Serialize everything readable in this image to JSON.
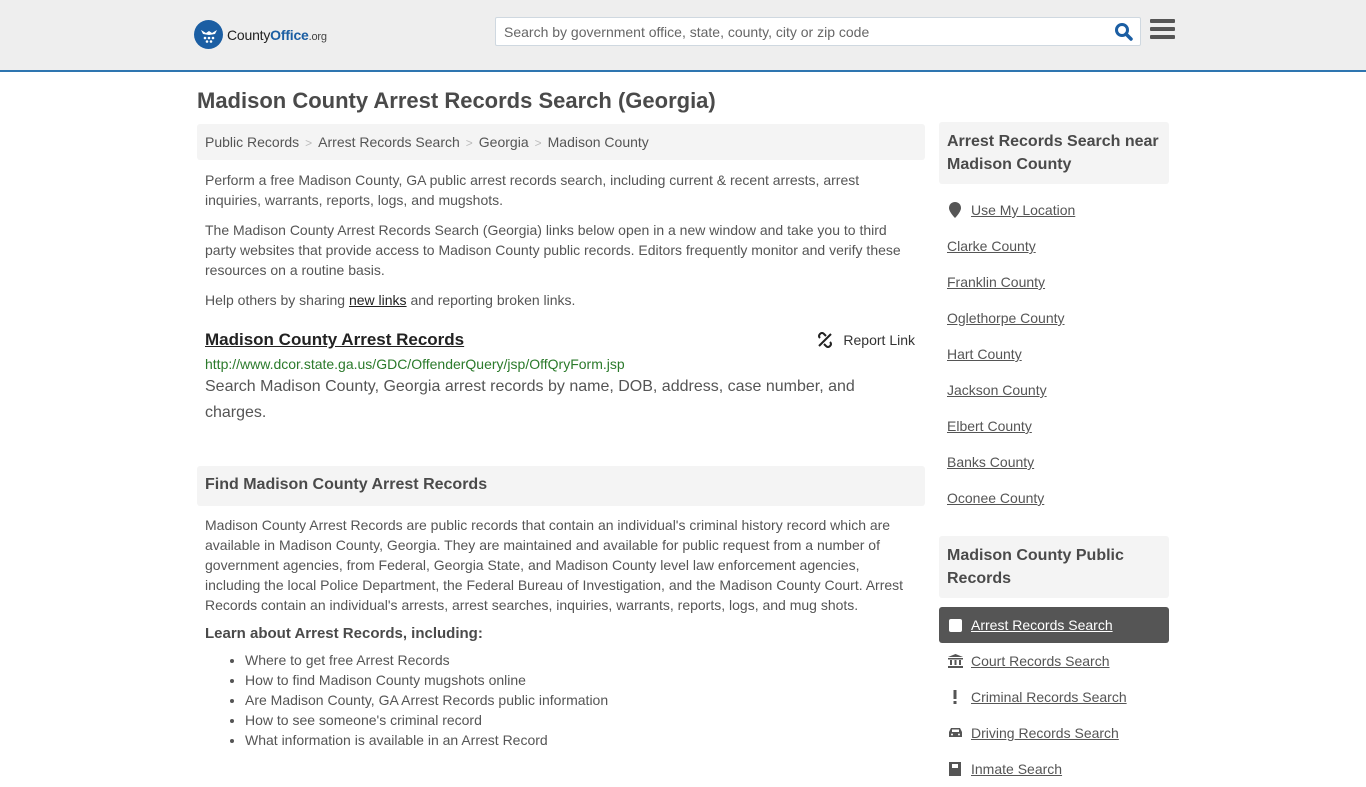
{
  "header": {
    "logo": {
      "county": "County",
      "office": "Office",
      "org": ".org"
    },
    "search": {
      "placeholder": "Search by government office, state, county, city or zip code",
      "value": ""
    },
    "colors": {
      "accent": "#2e75b0",
      "brand": "#1b5ea3",
      "url_green": "#2b7a2b"
    }
  },
  "page": {
    "title": "Madison County Arrest Records Search (Georgia)"
  },
  "breadcrumb": [
    "Public Records",
    "Arrest Records Search",
    "Georgia",
    "Madison County"
  ],
  "intro": {
    "p1": "Perform a free Madison County, GA public arrest records search, including current & recent arrests, arrest inquiries, warrants, reports, logs, and mugshots.",
    "p2": "The Madison County Arrest Records Search (Georgia) links below open in a new window and take you to third party websites that provide access to Madison County public records. Editors frequently monitor and verify these resources on a routine basis.",
    "p3_before": "Help others by sharing ",
    "p3_link": "new links",
    "p3_after": " and reporting broken links."
  },
  "resource": {
    "title": "Madison County Arrest Records",
    "report_label": "Report Link",
    "url": "http://www.dcor.state.ga.us/GDC/OffenderQuery/jsp/OffQryForm.jsp",
    "description": "Search Madison County, Georgia arrest records by name, DOB, address, case number, and charges."
  },
  "find": {
    "heading": "Find Madison County Arrest Records",
    "body": "Madison County Arrest Records are public records that contain an individual's criminal history record which are available in Madison County, Georgia. They are maintained and available for public request from a number of government agencies, from Federal, Georgia State, and Madison County level law enforcement agencies, including the local Police Department, the Federal Bureau of Investigation, and the Madison County Court. Arrest Records contain an individual's arrests, arrest searches, inquiries, warrants, reports, logs, and mug shots.",
    "learn_heading": "Learn about Arrest Records, including:",
    "bullets": [
      "Where to get free Arrest Records",
      "How to find Madison County mugshots online",
      "Are Madison County, GA Arrest Records public information",
      "How to see someone's criminal record",
      "What information is available in an Arrest Record"
    ]
  },
  "sidebar_near": {
    "heading": "Arrest Records Search near Madison County",
    "use_location": "Use My Location",
    "counties": [
      "Clarke County",
      "Franklin County",
      "Oglethorpe County",
      "Hart County",
      "Jackson County",
      "Elbert County",
      "Banks County",
      "Oconee County"
    ]
  },
  "sidebar_public": {
    "heading": "Madison County Public Records",
    "items": [
      {
        "label": "Arrest Records Search",
        "icon": "square-icon",
        "active": true
      },
      {
        "label": "Court Records Search",
        "icon": "courthouse-icon",
        "active": false
      },
      {
        "label": "Criminal Records Search",
        "icon": "exclamation-icon",
        "active": false
      },
      {
        "label": "Driving Records Search",
        "icon": "car-icon",
        "active": false
      },
      {
        "label": "Inmate Search",
        "icon": "inmate-icon",
        "active": false
      }
    ]
  }
}
